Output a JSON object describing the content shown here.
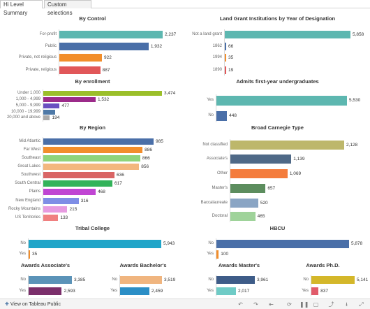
{
  "tabs": [
    "Hi Level Summary",
    "Custom selections"
  ],
  "footer": {
    "link": "View on Tableau Public"
  },
  "colors": {
    "teal": "#5db7b0",
    "blue": "#4a6fa8",
    "orange": "#f28e2b",
    "red": "#e15759",
    "lime": "#9bbf2a",
    "purple": "#9c2b8a",
    "indigo": "#6a4fc0",
    "steel": "#4e79a7",
    "grey": "#aaaaaa",
    "axis": "#d9d9d9"
  },
  "chart_data": [
    {
      "type": "bar",
      "title": "By Control",
      "categories": [
        "For-profit",
        "Public",
        "Private, not religious",
        "Private, religious"
      ],
      "values": [
        2237,
        1932,
        922,
        887
      ],
      "colors": [
        "#5db7b0",
        "#4a6fa8",
        "#f28e2b",
        "#e15759"
      ]
    },
    {
      "type": "bar",
      "title": "Land Grant Institutions by Year of Designation",
      "categories": [
        "Not a land grant",
        "1862",
        "1994",
        "1890"
      ],
      "values": [
        5858,
        66,
        35,
        19
      ],
      "colors": [
        "#5db7b0",
        "#4a6fa8",
        "#f28e2b",
        "#e15759"
      ]
    },
    {
      "type": "bar",
      "title": "By enrollment",
      "categories": [
        "Under 1,000",
        "1,000 - 4,999",
        "5,000 - 9,999",
        "10,000 - 19,999",
        "20,000 and above"
      ],
      "values": [
        3474,
        1532,
        477,
        339,
        194
      ],
      "value_labels": [
        "3,474",
        "1,532",
        "477",
        "",
        "194"
      ],
      "colors": [
        "#9bbf2a",
        "#9c2b8a",
        "#6a4fc0",
        "#4e79a7",
        "#aaaaaa"
      ]
    },
    {
      "type": "bar",
      "title": "Admits first-year undergraduates",
      "categories": [
        "Yes",
        "No"
      ],
      "values": [
        5530,
        448
      ],
      "colors": [
        "#5db7b0",
        "#4a6fa8"
      ]
    },
    {
      "type": "bar",
      "title": "By Region",
      "categories": [
        "Mid Atlantic",
        "Far West",
        "Southeast",
        "Great Lakes",
        "Southwest",
        "South Central",
        "Plains",
        "New England",
        "Rocky Mountains",
        "US Territories"
      ],
      "values": [
        985,
        886,
        866,
        856,
        636,
        617,
        468,
        316,
        215,
        133
      ],
      "colors": [
        "#4a6fa8",
        "#f28e2b",
        "#8fd47a",
        "#f3b77e",
        "#d96565",
        "#33b35a",
        "#c045d3",
        "#7f8ee6",
        "#e79be0",
        "#f08080"
      ]
    },
    {
      "type": "bar",
      "title": "Broad Carnegie Type",
      "categories": [
        "Not classified",
        "Associate's",
        "Other",
        "Master's",
        "Baccalaureate",
        "Doctoral"
      ],
      "values": [
        2128,
        1139,
        1069,
        657,
        520,
        465
      ],
      "colors": [
        "#bdb76b",
        "#4f6987",
        "#f47c3c",
        "#5c8d5e",
        "#8aa5c4",
        "#9fd39a"
      ]
    },
    {
      "type": "bar",
      "title": "Tribal College",
      "categories": [
        "No",
        "Yes"
      ],
      "values": [
        5943,
        35
      ],
      "colors": [
        "#20a5c9",
        "#f28e2b"
      ]
    },
    {
      "type": "bar",
      "title": "HBCU",
      "categories": [
        "No",
        "Yes"
      ],
      "values": [
        5878,
        100
      ],
      "colors": [
        "#4a6fa8",
        "#f28e2b"
      ]
    },
    {
      "type": "bar",
      "title": "Awards Associate's",
      "categories": [
        "No",
        "Yes"
      ],
      "values": [
        3385,
        2593
      ],
      "colors": [
        "#5b93b8",
        "#7a2e6a"
      ]
    },
    {
      "type": "bar",
      "title": "Awards Bachelor's",
      "categories": [
        "No",
        "Yes"
      ],
      "values": [
        3519,
        2459
      ],
      "colors": [
        "#f0b57f",
        "#2b8ec6"
      ]
    },
    {
      "type": "bar",
      "title": "Awards Master's",
      "categories": [
        "No",
        "Yes"
      ],
      "values": [
        3961,
        2017
      ],
      "colors": [
        "#3e5c88",
        "#6fcbc6"
      ]
    },
    {
      "type": "bar",
      "title": "Awards Ph.D.",
      "categories": [
        "No",
        "Yes"
      ],
      "values": [
        5141,
        837
      ],
      "colors": [
        "#d4b72a",
        "#e15b6a"
      ]
    }
  ]
}
